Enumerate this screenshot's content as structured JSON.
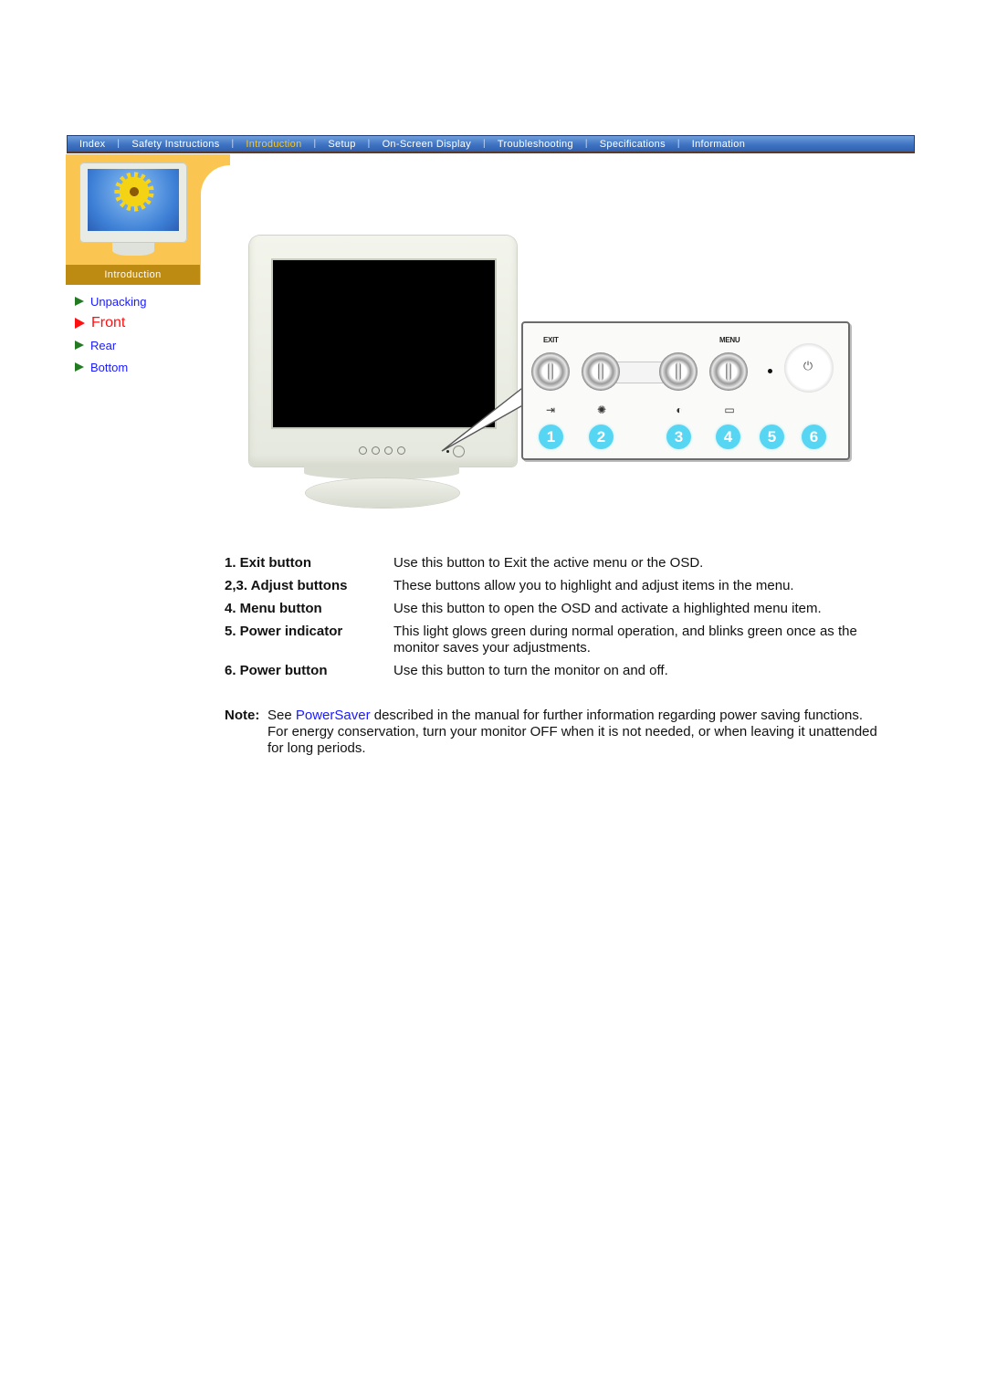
{
  "nav": {
    "items": [
      {
        "label": "Index",
        "active": false
      },
      {
        "label": "Safety Instructions",
        "active": false
      },
      {
        "label": "Introduction",
        "active": true
      },
      {
        "label": "Setup",
        "active": false
      },
      {
        "label": "On-Screen Display",
        "active": false
      },
      {
        "label": "Troubleshooting",
        "active": false
      },
      {
        "label": "Specifications",
        "active": false
      },
      {
        "label": "Information",
        "active": false
      }
    ],
    "active_color": "#f7c623",
    "separator": "|"
  },
  "sidebar": {
    "section_label": "Introduction",
    "items": [
      {
        "label": "Unpacking",
        "active": false
      },
      {
        "label": "Front",
        "active": true
      },
      {
        "label": "Rear",
        "active": false
      },
      {
        "label": "Bottom",
        "active": false
      }
    ]
  },
  "control_panel": {
    "exit_label": "EXIT",
    "menu_label": "MENU",
    "power_symbol": "⏻",
    "icons": [
      "exit-icon",
      "brightness-icon",
      "contrast-icon",
      "menu-icon"
    ],
    "icon_glyphs": [
      "⇥",
      "✺",
      "◐",
      "▭"
    ],
    "numbers": [
      "1",
      "2",
      "3",
      "4",
      "5",
      "6"
    ],
    "badge_color": "#57d6f3"
  },
  "descriptions": [
    {
      "term": "1. Exit button",
      "text": "Use this button to Exit the active menu or the OSD."
    },
    {
      "term": "2,3. Adjust buttons",
      "text": "These buttons allow you to highlight and adjust items in the menu."
    },
    {
      "term": "4. Menu button",
      "text": "Use this button to open the OSD and activate a highlighted menu item."
    },
    {
      "term": "5. Power indicator",
      "text": "This light glows green during normal operation, and blinks green once as the monitor saves your adjustments."
    },
    {
      "term": "6. Power button",
      "text": "Use this button to turn the monitor on and off."
    }
  ],
  "note": {
    "label": "Note:",
    "prefix": "See ",
    "link": "PowerSaver",
    "suffix": " described in the manual for further information regarding power saving functions. For energy conservation, turn your monitor OFF when it is not needed, or when leaving it unattended for long periods."
  }
}
